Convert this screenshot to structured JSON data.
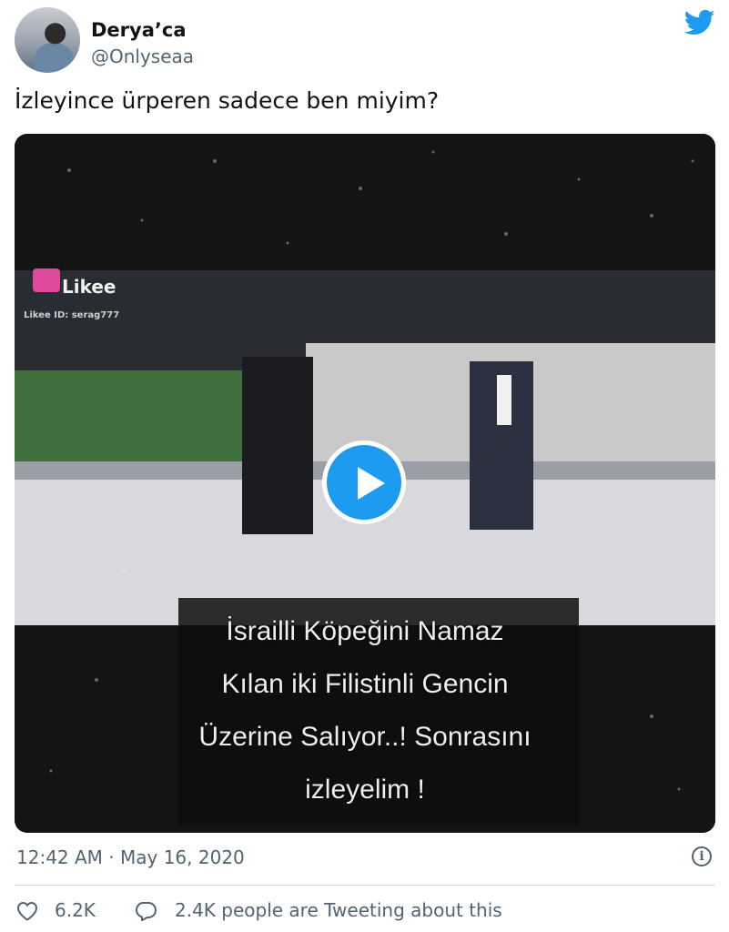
{
  "user": {
    "name": "Derya’ca",
    "handle": "@Onlyseaa"
  },
  "tweet": {
    "text": "İzleyince ürperen sadece ben miyim?"
  },
  "media": {
    "watermark": "Likee",
    "watermark_id": "Likee ID: serag777",
    "caption_lines": [
      "İsrailli  Köpeğini Namaz",
      "Kılan iki Filistinli Gencin",
      "Üzerine Salıyor..!  Sonrasını",
      "izleyelim !"
    ]
  },
  "meta": {
    "timestamp": "12:42 AM · May 16, 2020"
  },
  "actions": {
    "likes": "6.2K",
    "tweeting": "2.4K people are Tweeting about this"
  },
  "colors": {
    "accent": "#1d9bf0",
    "text": "#0f1419",
    "muted": "#536471"
  }
}
